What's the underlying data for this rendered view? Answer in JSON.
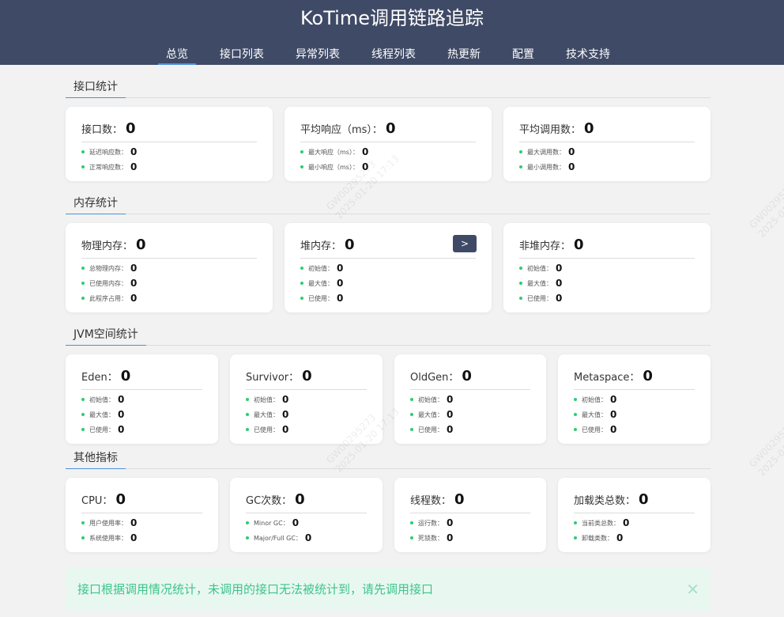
{
  "app_title": "KoTime调用链路追踪",
  "nav": [
    "总览",
    "接口列表",
    "异常列表",
    "线程列表",
    "热更新",
    "配置",
    "技术支持"
  ],
  "sections": {
    "interface": "接口统计",
    "memory": "内存统计",
    "jvm": "JVM空间统计",
    "other": "其他指标"
  },
  "cards": {
    "api_count": {
      "label": "接口数：",
      "value": "0",
      "items": [
        {
          "label": "延迟响应数：",
          "value": "0"
        },
        {
          "label": "正常响应数：",
          "value": "0"
        }
      ]
    },
    "avg_response": {
      "label": "平均响应（ms）：",
      "value": "0",
      "items": [
        {
          "label": "最大响应（ms）：",
          "value": "0"
        },
        {
          "label": "最小响应（ms）：",
          "value": "0"
        }
      ]
    },
    "avg_calls": {
      "label": "平均调用数：",
      "value": "0",
      "items": [
        {
          "label": "最大调用数：",
          "value": "0"
        },
        {
          "label": "最小调用数：",
          "value": "0"
        }
      ]
    },
    "physical_mem": {
      "label": "物理内存：",
      "value": "0",
      "items": [
        {
          "label": "总物理内存：",
          "value": "0"
        },
        {
          "label": "已使用内存：",
          "value": "0"
        },
        {
          "label": "此程序占用：",
          "value": "0"
        }
      ]
    },
    "heap_mem": {
      "label": "堆内存：",
      "value": "0",
      "button": ">",
      "items": [
        {
          "label": "初始值：",
          "value": "0"
        },
        {
          "label": "最大值：",
          "value": "0"
        },
        {
          "label": "已使用：",
          "value": "0"
        }
      ]
    },
    "nonheap_mem": {
      "label": "非堆内存：",
      "value": "0",
      "items": [
        {
          "label": "初始值：",
          "value": "0"
        },
        {
          "label": "最大值：",
          "value": "0"
        },
        {
          "label": "已使用：",
          "value": "0"
        }
      ]
    },
    "eden": {
      "label": "Eden：",
      "value": "0",
      "items": [
        {
          "label": "初始值：",
          "value": "0"
        },
        {
          "label": "最大值：",
          "value": "0"
        },
        {
          "label": "已使用：",
          "value": "0"
        }
      ]
    },
    "survivor": {
      "label": "Survivor：",
      "value": "0",
      "items": [
        {
          "label": "初始值：",
          "value": "0"
        },
        {
          "label": "最大值：",
          "value": "0"
        },
        {
          "label": "已使用：",
          "value": "0"
        }
      ]
    },
    "oldgen": {
      "label": "OldGen：",
      "value": "0",
      "items": [
        {
          "label": "初始值：",
          "value": "0"
        },
        {
          "label": "最大值：",
          "value": "0"
        },
        {
          "label": "已使用：",
          "value": "0"
        }
      ]
    },
    "metaspace": {
      "label": "Metaspace：",
      "value": "0",
      "items": [
        {
          "label": "初始值：",
          "value": "0"
        },
        {
          "label": "最大值：",
          "value": "0"
        },
        {
          "label": "已使用：",
          "value": "0"
        }
      ]
    },
    "cpu": {
      "label": "CPU：",
      "value": "0",
      "items": [
        {
          "label": "用户使用率：",
          "value": "0"
        },
        {
          "label": "系统使用率：",
          "value": "0"
        }
      ]
    },
    "gc": {
      "label": "GC次数：",
      "value": "0",
      "items": [
        {
          "label": "Minor GC：",
          "value": "0"
        },
        {
          "label": "Major/Full GC：",
          "value": "0"
        }
      ]
    },
    "threads": {
      "label": "线程数：",
      "value": "0",
      "items": [
        {
          "label": "运行数：",
          "value": "0"
        },
        {
          "label": "死锁数：",
          "value": "0"
        }
      ]
    },
    "classes": {
      "label": "加载类总数：",
      "value": "0",
      "items": [
        {
          "label": "当前类总数：",
          "value": "0"
        },
        {
          "label": "卸载类数：",
          "value": "0"
        }
      ]
    }
  },
  "notice": {
    "text": "接口根据调用情况统计，未调用的接口无法被统计到，请先调用接口",
    "close": "✕"
  },
  "watermark": {
    "line1": "GW00295273",
    "line2": "2025-01-20 17:13"
  }
}
